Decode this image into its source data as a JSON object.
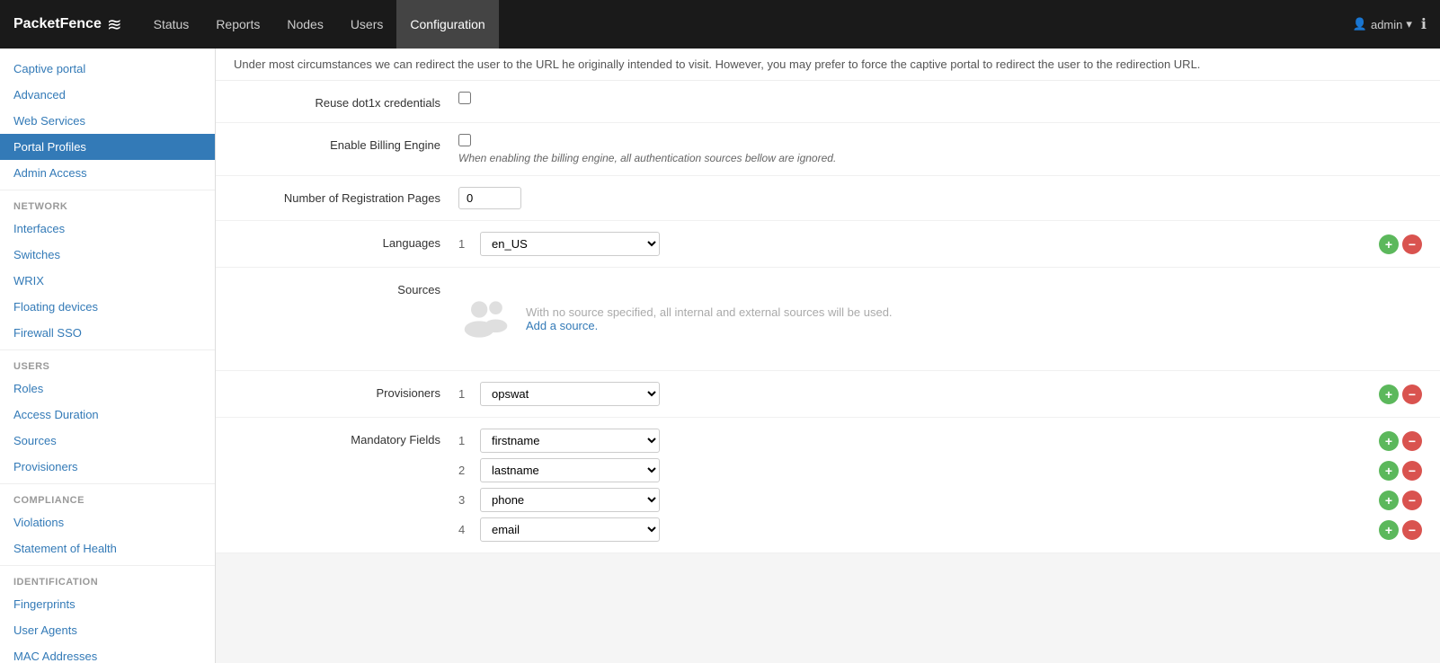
{
  "brand": {
    "name": "PacketFence",
    "logo_symbol": "≈"
  },
  "navbar": {
    "items": [
      {
        "label": "Status",
        "active": false
      },
      {
        "label": "Reports",
        "active": false
      },
      {
        "label": "Nodes",
        "active": false
      },
      {
        "label": "Users",
        "active": false
      },
      {
        "label": "Configuration",
        "active": true
      }
    ],
    "admin_label": "admin",
    "info_icon": "ℹ"
  },
  "sidebar": {
    "general_items": [
      {
        "label": "Captive portal",
        "active": false
      },
      {
        "label": "Advanced",
        "active": false
      },
      {
        "label": "Web Services",
        "active": false
      },
      {
        "label": "Portal Profiles",
        "active": true
      },
      {
        "label": "Admin Access",
        "active": false
      }
    ],
    "network_section": "NETWORK",
    "network_items": [
      {
        "label": "Interfaces",
        "active": false
      },
      {
        "label": "Switches",
        "active": false
      },
      {
        "label": "WRIX",
        "active": false
      },
      {
        "label": "Floating devices",
        "active": false
      },
      {
        "label": "Firewall SSO",
        "active": false
      }
    ],
    "users_section": "USERS",
    "users_items": [
      {
        "label": "Roles",
        "active": false
      },
      {
        "label": "Access Duration",
        "active": false
      },
      {
        "label": "Sources",
        "active": false
      },
      {
        "label": "Provisioners",
        "active": false
      }
    ],
    "compliance_section": "COMPLIANCE",
    "compliance_items": [
      {
        "label": "Violations",
        "active": false
      },
      {
        "label": "Statement of Health",
        "active": false
      }
    ],
    "identification_section": "IDENTIFICATION",
    "identification_items": [
      {
        "label": "Fingerprints",
        "active": false
      },
      {
        "label": "User Agents",
        "active": false
      },
      {
        "label": "MAC Addresses",
        "active": false
      }
    ]
  },
  "content": {
    "top_notice": "Under most circumstances we can redirect the user to the URL he originally intended to visit. However, you may prefer to force the captive portal to redirect the user to the redirection URL.",
    "fields": {
      "reuse_dot1x": {
        "label": "Reuse dot1x credentials",
        "checked": false
      },
      "billing_engine": {
        "label": "Enable Billing Engine",
        "checked": false,
        "helper": "When enabling the billing engine, all authentication sources bellow are ignored."
      },
      "num_reg_pages": {
        "label": "Number of Registration Pages",
        "value": "0"
      },
      "languages": {
        "label": "Languages",
        "items": [
          {
            "num": "1",
            "value": "en_US"
          }
        ]
      },
      "sources": {
        "label": "Sources",
        "empty_text": "With no source specified, all internal and external sources will be used.",
        "add_link": "Add a source."
      },
      "provisioners": {
        "label": "Provisioners",
        "items": [
          {
            "num": "1",
            "value": "opswat"
          }
        ]
      },
      "mandatory_fields": {
        "label": "Mandatory Fields",
        "items": [
          {
            "num": "1",
            "value": "firstname"
          },
          {
            "num": "2",
            "value": "lastname"
          },
          {
            "num": "3",
            "value": "phone"
          },
          {
            "num": "4",
            "value": "email"
          }
        ]
      }
    }
  }
}
